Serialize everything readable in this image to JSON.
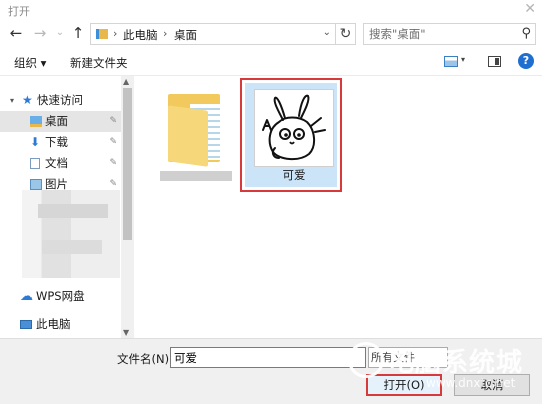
{
  "window": {
    "title": "打开",
    "close_glyph": "✕"
  },
  "address": {
    "back_glyph": "←",
    "forward_glyph": "→",
    "recent_glyph": "⌄",
    "up_glyph": "↑",
    "crumbs": [
      "此电脑",
      "桌面"
    ],
    "separator": "›",
    "refresh_glyph": "↻",
    "dropdown_glyph": "⌄"
  },
  "search": {
    "placeholder": "搜索\"桌面\"",
    "icon_glyph": "⚲"
  },
  "toolbar": {
    "organize_label": "组织 ▾",
    "new_folder_label": "新建文件夹",
    "help_label": "?",
    "view_dropdown_glyph": "▾"
  },
  "sidebar": {
    "items": [
      {
        "label": "快速访问",
        "icon": "star-icon",
        "expander": "▾"
      },
      {
        "label": "桌面",
        "icon": "desktop-folder-icon",
        "pin": "📌"
      },
      {
        "label": "下载",
        "icon": "download-icon",
        "pin": "📌"
      },
      {
        "label": "文档",
        "icon": "document-icon",
        "pin": "📌"
      },
      {
        "label": "图片",
        "icon": "picture-icon",
        "pin": "📌"
      },
      {
        "label": "WPS网盘",
        "icon": "cloud-icon"
      },
      {
        "label": "此电脑",
        "icon": "computer-icon"
      }
    ]
  },
  "files": [
    {
      "name": "",
      "type": "folder"
    },
    {
      "name": "可爱",
      "type": "image",
      "selected": true
    }
  ],
  "bottom": {
    "filename_label": "文件名(N):",
    "filename_value": "可爱",
    "filter_value": "所有文件",
    "open_label": "打开(O)",
    "cancel_label": "取消"
  },
  "watermark": {
    "brand": "电脑系统城",
    "url": "www.dnxtc.net"
  },
  "colors": {
    "accent": "#1e6fd0",
    "highlight": "#d63a3a",
    "selection": "#cce4f7"
  }
}
